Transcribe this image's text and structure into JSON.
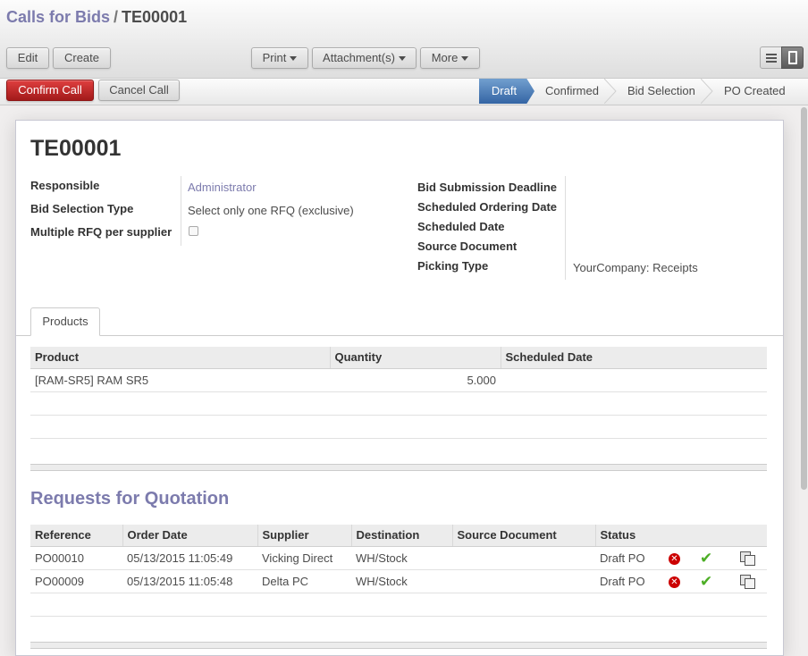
{
  "breadcrumb": {
    "parent": "Calls for Bids",
    "separator": "/",
    "current": "TE00001"
  },
  "toolbar": {
    "edit": "Edit",
    "create": "Create",
    "print": "Print",
    "attachments": "Attachment(s)",
    "more": "More",
    "view_list_icon": "list-view-icon",
    "view_form_icon": "form-view-icon"
  },
  "actions": {
    "confirm": "Confirm Call",
    "cancel": "Cancel Call"
  },
  "statusbar": {
    "stages": [
      "Draft",
      "Confirmed",
      "Bid Selection",
      "PO Created"
    ],
    "active": "Draft",
    "active_color": "#3465a4"
  },
  "record": {
    "title": "TE00001",
    "left_fields": {
      "responsible_label": "Responsible",
      "responsible_value": "Administrator",
      "bid_selection_type_label": "Bid Selection Type",
      "bid_selection_type_value": "Select only one RFQ (exclusive)",
      "multiple_rfq_label": "Multiple RFQ per supplier",
      "multiple_rfq_checked": false
    },
    "right_fields": {
      "bid_deadline_label": "Bid Submission Deadline",
      "ordering_date_label": "Scheduled Ordering Date",
      "scheduled_date_label": "Scheduled Date",
      "source_document_label": "Source Document",
      "picking_type_label": "Picking Type",
      "picking_type_value": "YourCompany: Receipts"
    }
  },
  "tabs": [
    "Products"
  ],
  "products_table": {
    "headers": [
      "Product",
      "Quantity",
      "Scheduled Date"
    ],
    "rows": [
      [
        "[RAM-SR5] RAM SR5",
        "5.000",
        ""
      ]
    ]
  },
  "rfq": {
    "title": "Requests for Quotation",
    "headers": [
      "Reference",
      "Order Date",
      "Supplier",
      "Destination",
      "Source Document",
      "Status"
    ],
    "rows": [
      [
        "PO00010",
        "05/13/2015 11:05:49",
        "Vicking Direct",
        "WH/Stock",
        "",
        "Draft PO"
      ],
      [
        "PO00009",
        "05/13/2015 11:05:48",
        "Delta PC",
        "WH/Stock",
        "",
        "Draft PO"
      ]
    ],
    "row_icons": [
      "cancel-icon",
      "check-icon",
      "copy-icon"
    ]
  },
  "colors": {
    "brand": "#7c7bad",
    "primary_button": "#a21a1a"
  }
}
